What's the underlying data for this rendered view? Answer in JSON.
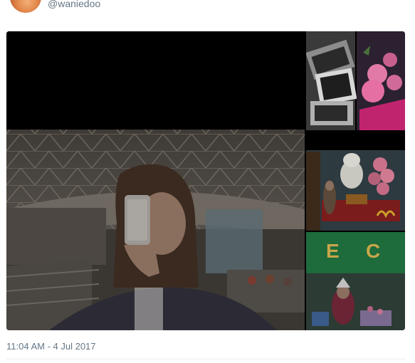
{
  "tweet": {
    "handle": "@waniedoo",
    "timestamp": "11:04 AM - 4 Jul 2017"
  },
  "media": {
    "main": {
      "icon": "photo-airport-selfie"
    },
    "thumbs": [
      {
        "icon": "photo-gift-boxes-bw"
      },
      {
        "icon": "photo-pink-roses-bouquet"
      },
      {
        "icon": "photo-mcdonalds-party"
      },
      {
        "icon": "photo-christmas-store"
      }
    ]
  }
}
